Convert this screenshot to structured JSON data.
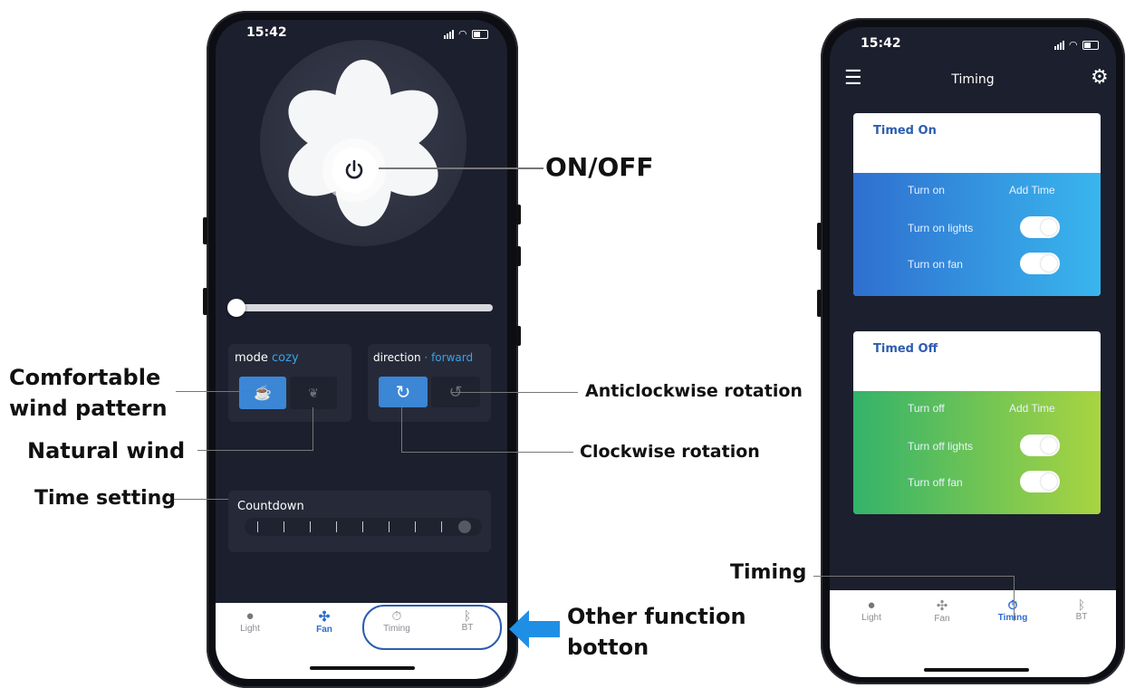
{
  "left_phone": {
    "time": "15:42",
    "mode": {
      "label": "mode",
      "value": "cozy"
    },
    "direction": {
      "label": "direction",
      "separator": "·",
      "value": "forward"
    },
    "countdown_label": "Countdown",
    "speed_level": 0.0,
    "tabs": [
      {
        "label": "Light",
        "icon": "bulb-icon"
      },
      {
        "label": "Fan",
        "icon": "fan-icon"
      },
      {
        "label": "Timing",
        "icon": "timer-icon"
      },
      {
        "label": "BT",
        "icon": "bluetooth-icon"
      }
    ],
    "active_tab": "Fan"
  },
  "right_phone": {
    "time": "15:42",
    "header_title": "Timing",
    "timed_on": {
      "title": "Timed On",
      "col_left": "Turn on",
      "col_right": "Add Time",
      "rows": [
        "Turn on lights",
        "Turn on fan"
      ]
    },
    "timed_off": {
      "title": "Timed Off",
      "col_left": "Turn off",
      "col_right": "Add Time",
      "rows": [
        "Turn off lights",
        "Turn off fan"
      ]
    },
    "tabs": [
      {
        "label": "Light",
        "icon": "bulb-icon"
      },
      {
        "label": "Fan",
        "icon": "fan-icon"
      },
      {
        "label": "Timing",
        "icon": "timer-icon"
      },
      {
        "label": "BT",
        "icon": "bluetooth-icon"
      }
    ],
    "active_tab": "Timing"
  },
  "annotations": {
    "on_off": "ON/OFF",
    "comfortable": [
      "Comfortable",
      "wind pattern"
    ],
    "natural": "Natural wind",
    "time_setting": "Time setting",
    "anticlockwise": "Anticlockwise rotation",
    "clockwise": "Clockwise rotation",
    "other_function": [
      "Other function",
      "botton"
    ],
    "timing": "Timing"
  },
  "colors": {
    "screen_bg": "#1c1f2d",
    "accent_blue": "#3c86d6",
    "timed_on_gradient": [
      "#2f6fcf",
      "#39b6ee"
    ],
    "timed_off_gradient": [
      "#33b36a",
      "#a9d441"
    ],
    "arrow_blue": "#1f8fe6"
  }
}
